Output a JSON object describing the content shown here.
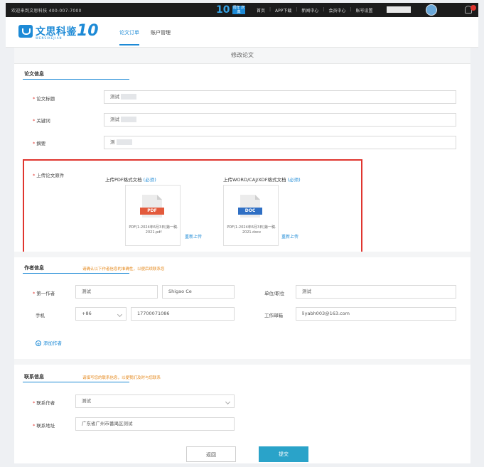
{
  "topbar": {
    "welcome": "欢迎来到文思科技 400-007-7000",
    "ten_label": "10",
    "ten_badge": "周年 庆典",
    "links": [
      "首页",
      "APP下载",
      "新闻中心",
      "会员中心",
      "账号设置"
    ]
  },
  "header": {
    "logo_name": "文思科鉴",
    "logo_sub": "WENSIKEJIAN",
    "logo_num": "10",
    "tabs": [
      "论文订单",
      "账户管理"
    ],
    "active_tab": "论文订单"
  },
  "page": {
    "title": "修改论文"
  },
  "paper_info": {
    "section_title": "论文信息",
    "fields": [
      {
        "label": "论文标题",
        "value": "测试"
      },
      {
        "label": "关键词",
        "value": "测试"
      },
      {
        "label": "摘要",
        "value": "测"
      }
    ],
    "upload_label": "上传论文原件",
    "uploads": [
      {
        "caption": "上传PDF格式文档",
        "caption_link": "(必须)",
        "file_type": "PDF",
        "file_name": "PDF(1-2024年6月3日)第一稿. 2021.pdf",
        "reupload": "重新上传",
        "tag_color": "#e35a3c"
      },
      {
        "caption": "上传WORD/CAJ/XDF格式文档",
        "caption_link": "(必须)",
        "file_type": "DOC",
        "file_name": "PDF(1-2024年6月3日)第一稿. 2021.docx",
        "reupload": "重新上传",
        "tag_color": "#2f6fc4"
      }
    ]
  },
  "author_info": {
    "section_title": "作者信息",
    "hint": "请确认以下作者信息的准确性，以便后续联系您",
    "first_author_label": "第一作者",
    "first_author_value": "测试",
    "pinyin_value": "Shigao Ce",
    "unit_label": "单位/职位",
    "unit_value": "测试",
    "phone_label": "手机",
    "phone_code": "+86",
    "phone_value": "17700071086",
    "email_label": "工作邮箱",
    "email_value": "liyabh003@163.com",
    "add_author": "添加作者"
  },
  "contact_info": {
    "section_title": "联系信息",
    "hint": "请填写您的联系信息，以便我们及时与您联系",
    "contact_label": "联系作者",
    "contact_value": "测试",
    "address_label": "联系地址",
    "address_value": "广东省广州市番禺区测试"
  },
  "actions": {
    "back": "返回",
    "submit": "提交"
  }
}
